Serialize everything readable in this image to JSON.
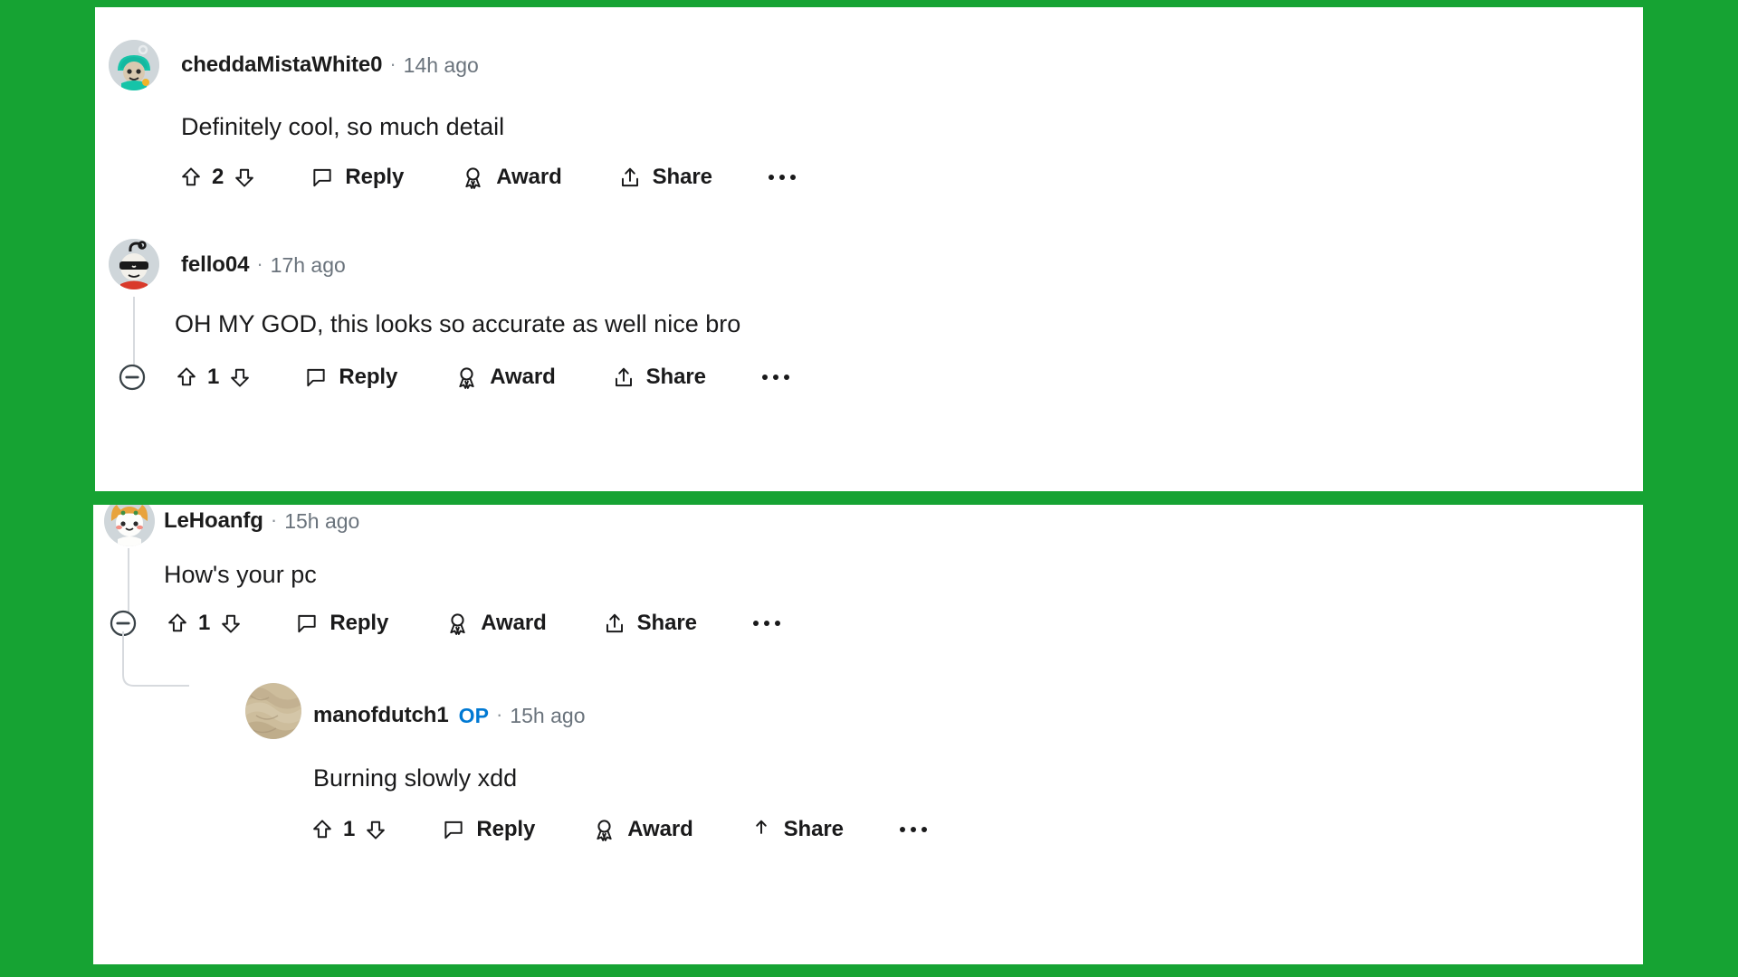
{
  "theme": {
    "background_color": "#16a333",
    "panel_color": "#ffffff",
    "text_color": "#1a1a1b",
    "meta_color": "#6a737c",
    "op_badge_color": "#0079d3",
    "thread_line_color": "#d7dade"
  },
  "actions": {
    "reply_label": "Reply",
    "award_label": "Award",
    "share_label": "Share",
    "upvote_icon": "upvote-arrow-icon",
    "downvote_icon": "downvote-arrow-icon",
    "reply_icon": "speech-bubble-icon",
    "award_icon": "award-ribbon-icon",
    "share_icon": "share-arrow-icon",
    "overflow_icon": "more-options-icon",
    "collapse_icon": "collapse-minus-icon"
  },
  "panels": [
    {
      "id": "panel-top",
      "comments": [
        {
          "username": "cheddaMistaWhite0",
          "timestamp": "14h ago",
          "separator": "·",
          "op": false,
          "body": "Definitely cool, so much detail",
          "vote_count": "2",
          "has_collapse": false,
          "avatar_name": "avatar-cheddamistawhite0"
        },
        {
          "username": "fello04",
          "timestamp": "17h ago",
          "separator": "·",
          "op": false,
          "body": "OH MY GOD, this looks so accurate as well nice bro",
          "vote_count": "1",
          "has_collapse": true,
          "avatar_name": "avatar-fello04"
        }
      ]
    },
    {
      "id": "panel-bottom",
      "comments": [
        {
          "username": "LeHoanfg",
          "timestamp": "15h ago",
          "separator": "·",
          "op": false,
          "body": "How's your pc",
          "vote_count": "1",
          "has_collapse": true,
          "avatar_name": "avatar-lehoanfg"
        },
        {
          "username": "manofdutch1",
          "op_label": "OP",
          "timestamp": "15h ago",
          "separator": "·",
          "op": true,
          "body": "Burning slowly xdd",
          "vote_count": "1",
          "has_collapse": false,
          "avatar_name": "avatar-manofdutch1"
        }
      ]
    }
  ]
}
